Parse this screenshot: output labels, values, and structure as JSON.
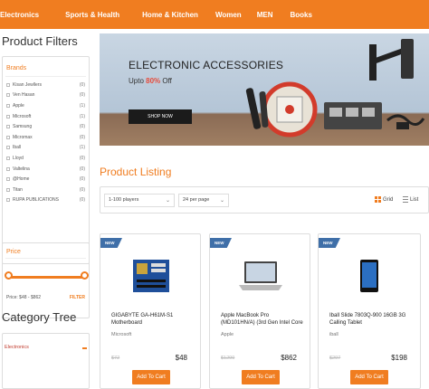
{
  "nav": {
    "items": [
      "Electronics",
      "Sports & Health",
      "Home & Kitchen",
      "Women",
      "MEN",
      "Books"
    ]
  },
  "filters": {
    "title": "Product Filters",
    "brands_heading": "Brands",
    "brands": [
      {
        "name": "Kisan Jewllers",
        "count": "(0)"
      },
      {
        "name": "Ven Hasan",
        "count": "(0)"
      },
      {
        "name": "Apple",
        "count": "(1)"
      },
      {
        "name": "Microsoft",
        "count": "(1)"
      },
      {
        "name": "Samsung",
        "count": "(0)"
      },
      {
        "name": "Micromax",
        "count": "(0)"
      },
      {
        "name": "Iball",
        "count": "(1)"
      },
      {
        "name": "Lloyd",
        "count": "(0)"
      },
      {
        "name": "Valtelina",
        "count": "(0)"
      },
      {
        "name": "@Home",
        "count": "(0)"
      },
      {
        "name": "Titan",
        "count": "(0)"
      },
      {
        "name": "RUPA PUBLICATIONS",
        "count": "(0)"
      }
    ],
    "price_heading": "Price",
    "price_range": "Price: $48 - $862",
    "filter_label": "FILTER"
  },
  "category": {
    "title": "Category Tree",
    "items": [
      "Electronics"
    ]
  },
  "banner": {
    "title": "ELECTRONIC ACCESSORIES",
    "sub_prefix": "Upto ",
    "sub_pct": "80%",
    "sub_suffix": " Off",
    "button": "SHOP NOW"
  },
  "listing": {
    "title": "Product Listing",
    "players_select": "1-100 players",
    "per_page_select": "24 per page",
    "grid_label": "Grid",
    "list_label": "List"
  },
  "products": [
    {
      "badge": "NEW",
      "name": "GIGABYTE GA-H61M-S1 Motherboard",
      "brand": "Microsoft",
      "old_price": "$72",
      "price": "$48",
      "cart": "Add To Cart"
    },
    {
      "badge": "NEW",
      "name": "Apple MacBook Pro (MD101HN/A) (3rd Gen Intel Core",
      "brand": "Apple",
      "old_price": "$1299",
      "price": "$862",
      "cart": "Add To Cart"
    },
    {
      "badge": "NEW",
      "name": "Iball Slide 7803Q-900 16GB 3G Calling Tablet",
      "brand": "iball",
      "old_price": "$297",
      "price": "$198",
      "cart": "Add To Cart"
    }
  ],
  "colors": {
    "accent": "#f07d20",
    "badge": "#3f6fa8"
  }
}
